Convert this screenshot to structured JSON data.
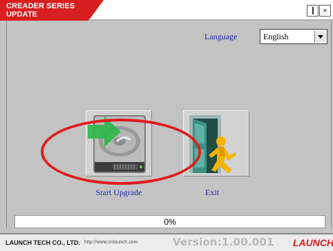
{
  "window": {
    "title": "CREADER SERIES UPDATE",
    "minimize_label": "",
    "close_label": "×"
  },
  "language": {
    "label": "Language",
    "selected": "English"
  },
  "actions": {
    "start_upgrade_label": "Start Upgrade",
    "exit_label": "Exit",
    "start_upgrade_icon": "hard-drive-download-icon",
    "exit_icon": "exit-door-icon"
  },
  "progress": {
    "value": 0,
    "text": "0%"
  },
  "footer": {
    "company": "LAUNCH TECH CO., LTD.",
    "website": "http://www.cnlaunch.com",
    "version": "Version:1.00.001",
    "brand": "LAUNCH"
  },
  "colors": {
    "accent_red": "#d81e1e",
    "link_blue": "#2a2ab0",
    "annotation_red": "#e01c1c"
  }
}
